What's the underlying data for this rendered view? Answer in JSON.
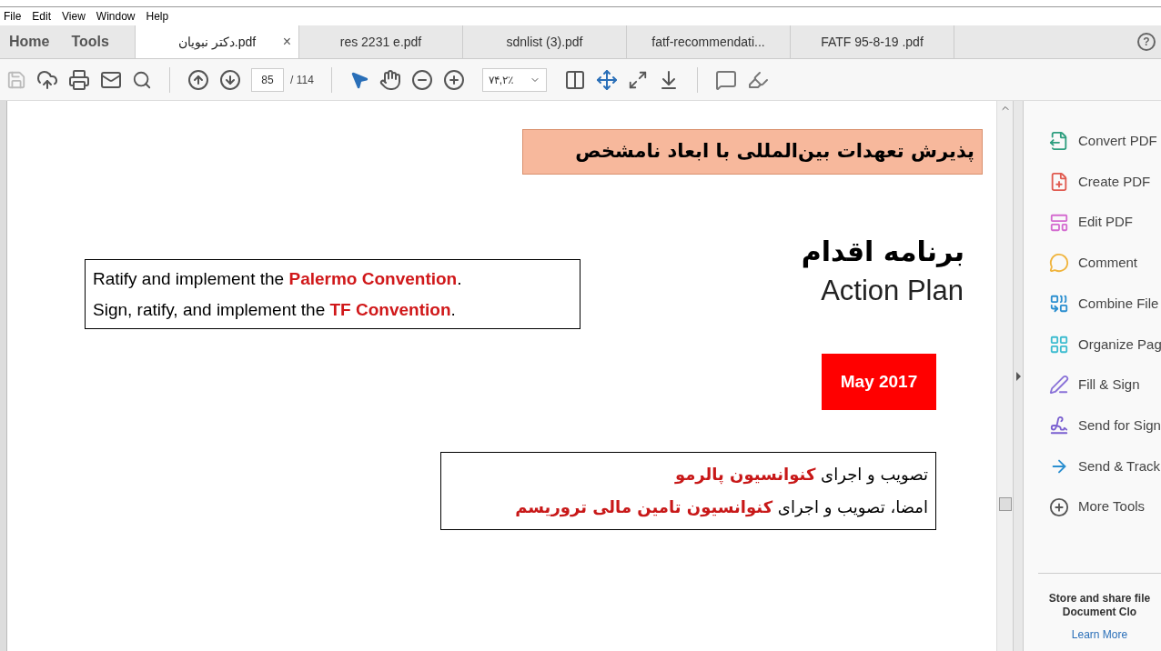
{
  "menu": [
    "File",
    "Edit",
    "View",
    "Window",
    "Help"
  ],
  "nav_tabs": [
    {
      "label": "Home",
      "selected": false
    },
    {
      "label": "Tools",
      "selected": false
    }
  ],
  "doc_tabs": [
    {
      "label": "دکتر نبویان.pdf",
      "selected": true,
      "closable": true
    },
    {
      "label": "res 2231 e.pdf",
      "selected": false,
      "closable": false
    },
    {
      "label": "sdnlist (3).pdf",
      "selected": false,
      "closable": false
    },
    {
      "label": "fatf-recommendati...",
      "selected": false,
      "closable": false
    },
    {
      "label": "FATF  95-8-19  .pdf",
      "selected": false,
      "closable": false
    }
  ],
  "close_glyph": "×",
  "help_glyph": "?",
  "toolbar": {
    "page": "85",
    "page_total": "/ 114",
    "zoom": "۷۴,۲٪"
  },
  "document": {
    "banner": "پذیرش تعهدات بین‌المللی با ابعاد نامشخص",
    "heading_fa": "برنامه اقدام",
    "heading_en": "Action Plan",
    "date_badge": "May 2017",
    "english_lines": [
      [
        {
          "text": "Ratify and implement the ",
          "highlight": false
        },
        {
          "text": "Palermo Convention",
          "highlight": true
        },
        {
          "text": ".",
          "highlight": false
        }
      ],
      [
        {
          "text": "Sign, ratify, and implement the ",
          "highlight": false
        },
        {
          "text": "TF Convention",
          "highlight": true
        },
        {
          "text": ".",
          "highlight": false
        }
      ]
    ],
    "persian_lines": [
      [
        {
          "text": "تصویب و اجرای ",
          "highlight": false
        },
        {
          "text": "کنوانسیون پالرمو",
          "highlight": true
        }
      ],
      [
        {
          "text": "امضا، تصویب و اجرای ",
          "highlight": false
        },
        {
          "text": "کنوانسیون تامین مالی تروریسم",
          "highlight": true
        }
      ]
    ]
  },
  "tools_panel": {
    "items": [
      "Convert PDF",
      "Create PDF",
      "Edit PDF",
      "Comment",
      "Combine File",
      "Organize Pag",
      "Fill & Sign",
      "Send for Sign",
      "Send & Track",
      "More Tools"
    ],
    "promo": [
      "Store and share file",
      "Document Clo"
    ],
    "link": "Learn More"
  }
}
